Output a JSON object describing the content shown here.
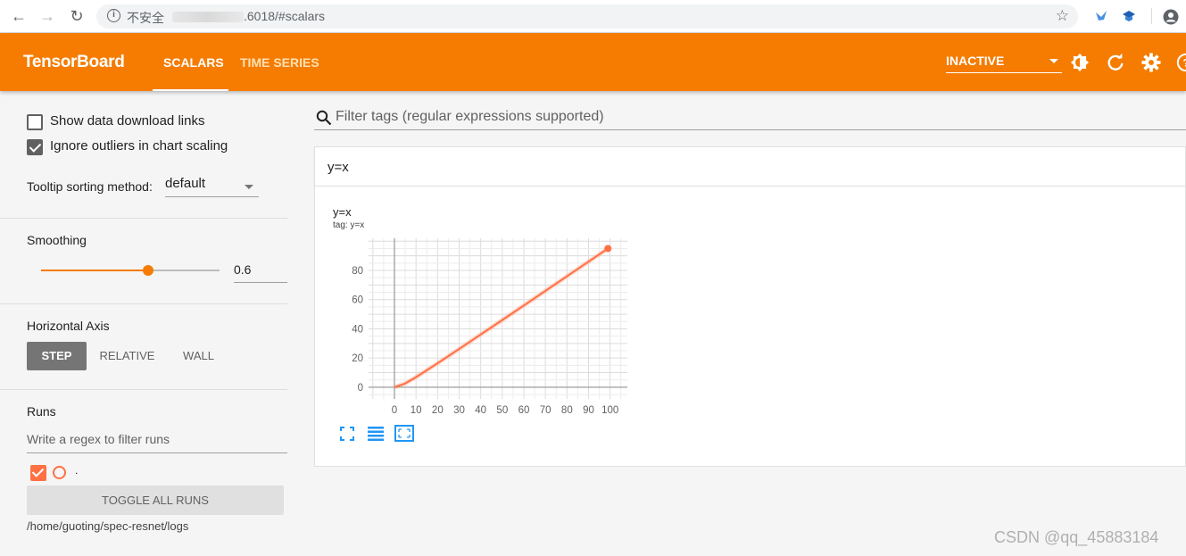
{
  "browser": {
    "insecure_label": "不安全",
    "url": ".6018/#scalars"
  },
  "header": {
    "brand": "TensorBoard",
    "tabs": [
      {
        "label": "SCALARS",
        "active": true
      },
      {
        "label": "TIME SERIES",
        "active": false
      }
    ],
    "run_status": "INACTIVE",
    "icons": [
      "theme-toggle-icon",
      "reload-icon",
      "settings-icon",
      "help-icon"
    ],
    "accent": "#f57c00"
  },
  "sidebar": {
    "download_links_label": "Show data download links",
    "download_links_checked": false,
    "ignore_outliers_label": "Ignore outliers in chart scaling",
    "ignore_outliers_checked": true,
    "tooltip_sorting_label": "Tooltip sorting method:",
    "tooltip_sorting_value": "default",
    "smoothing_label": "Smoothing",
    "smoothing_value": "0.6",
    "smoothing_fraction": 0.6,
    "horizontal_axis_label": "Horizontal Axis",
    "axis_options": [
      "STEP",
      "RELATIVE",
      "WALL"
    ],
    "axis_selected": "STEP",
    "runs_label": "Runs",
    "runs_filter_placeholder": "Write a regex to filter runs",
    "runs": [
      {
        "name": ".",
        "checked": true,
        "color": "#ff7043"
      }
    ],
    "toggle_all_label": "TOGGLE ALL RUNS",
    "logdir": "/home/guoting/spec-resnet/logs"
  },
  "main": {
    "filter_placeholder": "Filter tags (regular expressions supported)",
    "category": "y=x",
    "card": {
      "title": "y=x",
      "tag": "tag: y=x",
      "toolbar_icons": [
        "fullscreen-icon",
        "log-scale-icon",
        "fit-domain-icon"
      ]
    }
  },
  "chart_data": {
    "type": "line",
    "title": "y=x",
    "xlabel": "",
    "ylabel": "",
    "x": [
      0,
      5,
      10,
      20,
      30,
      40,
      50,
      60,
      70,
      80,
      90,
      99
    ],
    "series": [
      {
        "values": [
          0,
          2.6,
          6.9,
          16.4,
          26.2,
          36.1,
          46.0,
          56.0,
          66.0,
          76.0,
          86.0,
          95.0
        ],
        "color": "#ff7043"
      }
    ],
    "xlim": [
      -12,
      108
    ],
    "ylim": [
      -8,
      102
    ],
    "xticks": [
      0,
      10,
      20,
      30,
      40,
      50,
      60,
      70,
      80,
      90,
      100
    ],
    "yticks": [
      0,
      20,
      40,
      60,
      80
    ],
    "grid": true
  },
  "watermark": "CSDN @qq_45883184"
}
